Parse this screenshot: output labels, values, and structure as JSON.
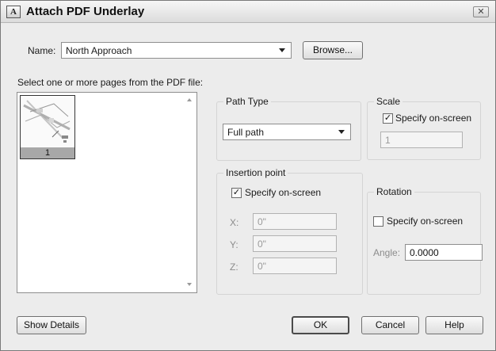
{
  "window": {
    "title": "Attach PDF Underlay",
    "app_icon_glyph": "A",
    "close_glyph": "✕"
  },
  "name_row": {
    "label": "Name:",
    "value": "North Approach",
    "browse_label": "Browse..."
  },
  "pages": {
    "prompt": "Select one or more pages from the PDF file:",
    "items": [
      {
        "label": "1",
        "selected": true
      }
    ]
  },
  "path_type": {
    "title": "Path Type",
    "value": "Full path"
  },
  "scale": {
    "title": "Scale",
    "specify_label": "Specify on-screen",
    "specify_checked": true,
    "value": "1"
  },
  "insertion": {
    "title": "Insertion point",
    "specify_label": "Specify on-screen",
    "specify_checked": true,
    "x_label": "X:",
    "x_value": "0\"",
    "y_label": "Y:",
    "y_value": "0\"",
    "z_label": "Z:",
    "z_value": "0\""
  },
  "rotation": {
    "title": "Rotation",
    "specify_label": "Specify on-screen",
    "specify_checked": false,
    "angle_label": "Angle:",
    "angle_value": "0.0000"
  },
  "footer": {
    "details_label": "Show Details",
    "ok_label": "OK",
    "cancel_label": "Cancel",
    "help_label": "Help"
  },
  "colors": {
    "dialog_bg": "#ececec",
    "thumb_label_bg": "#a8a8a8",
    "disabled_text": "#8c8c8c"
  }
}
